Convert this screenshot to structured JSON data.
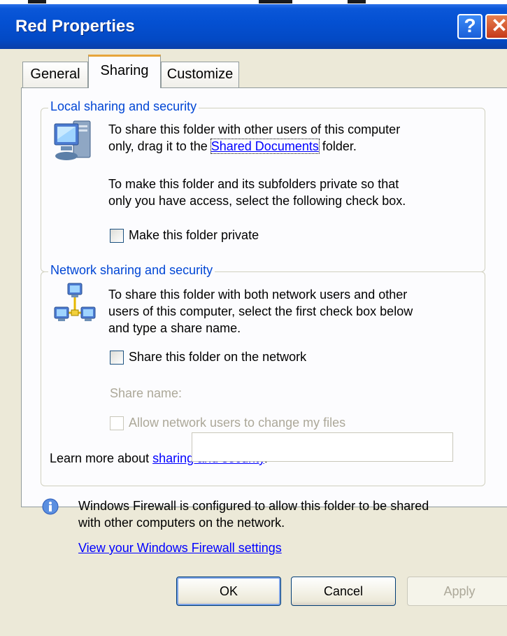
{
  "window": {
    "title": "Red Properties",
    "help_glyph": "?",
    "close_glyph": "✕"
  },
  "tabs": [
    {
      "label": "General"
    },
    {
      "label": "Sharing"
    },
    {
      "label": "Customize"
    }
  ],
  "local": {
    "legend": "Local sharing and security",
    "text1_line1": "To share this folder with other users of this computer",
    "text1_pre": "only, drag it to the ",
    "shared_docs_link": "Shared Documents",
    "text1_post": " folder.",
    "text2_line1": "To make this folder and its subfolders private so that",
    "text2_line2": "only you have access, select the following check box.",
    "private_label": "Make this folder private"
  },
  "network": {
    "legend": "Network sharing and security",
    "text_line1": "To share this folder with both network users and other",
    "text_line2": "users of this computer, select the first check box below",
    "text_line3": "and type a share name.",
    "share_label": "Share this folder on the network",
    "share_name_label": "Share name:",
    "share_name_value": "",
    "allow_label": "Allow network users to change my files",
    "learn_pre": "Learn more about ",
    "learn_link": "sharing and security",
    "learn_post": "."
  },
  "firewall": {
    "line1": "Windows Firewall is configured to allow this folder to be shared",
    "line2": "with other computers on the network.",
    "link": "View your Windows Firewall settings"
  },
  "buttons": {
    "ok": "OK",
    "cancel": "Cancel",
    "apply": "Apply"
  },
  "icons": {
    "local": "computer-icon",
    "network": "network-icon",
    "firewall": "info-icon"
  },
  "colors": {
    "titlebar": "#0450D2",
    "dialog_bg": "#ECE9D8",
    "page_bg": "#FCFCFE",
    "legend": "#0046D5",
    "link": "#0000FF",
    "tab_highlight": "#E7A53A"
  }
}
